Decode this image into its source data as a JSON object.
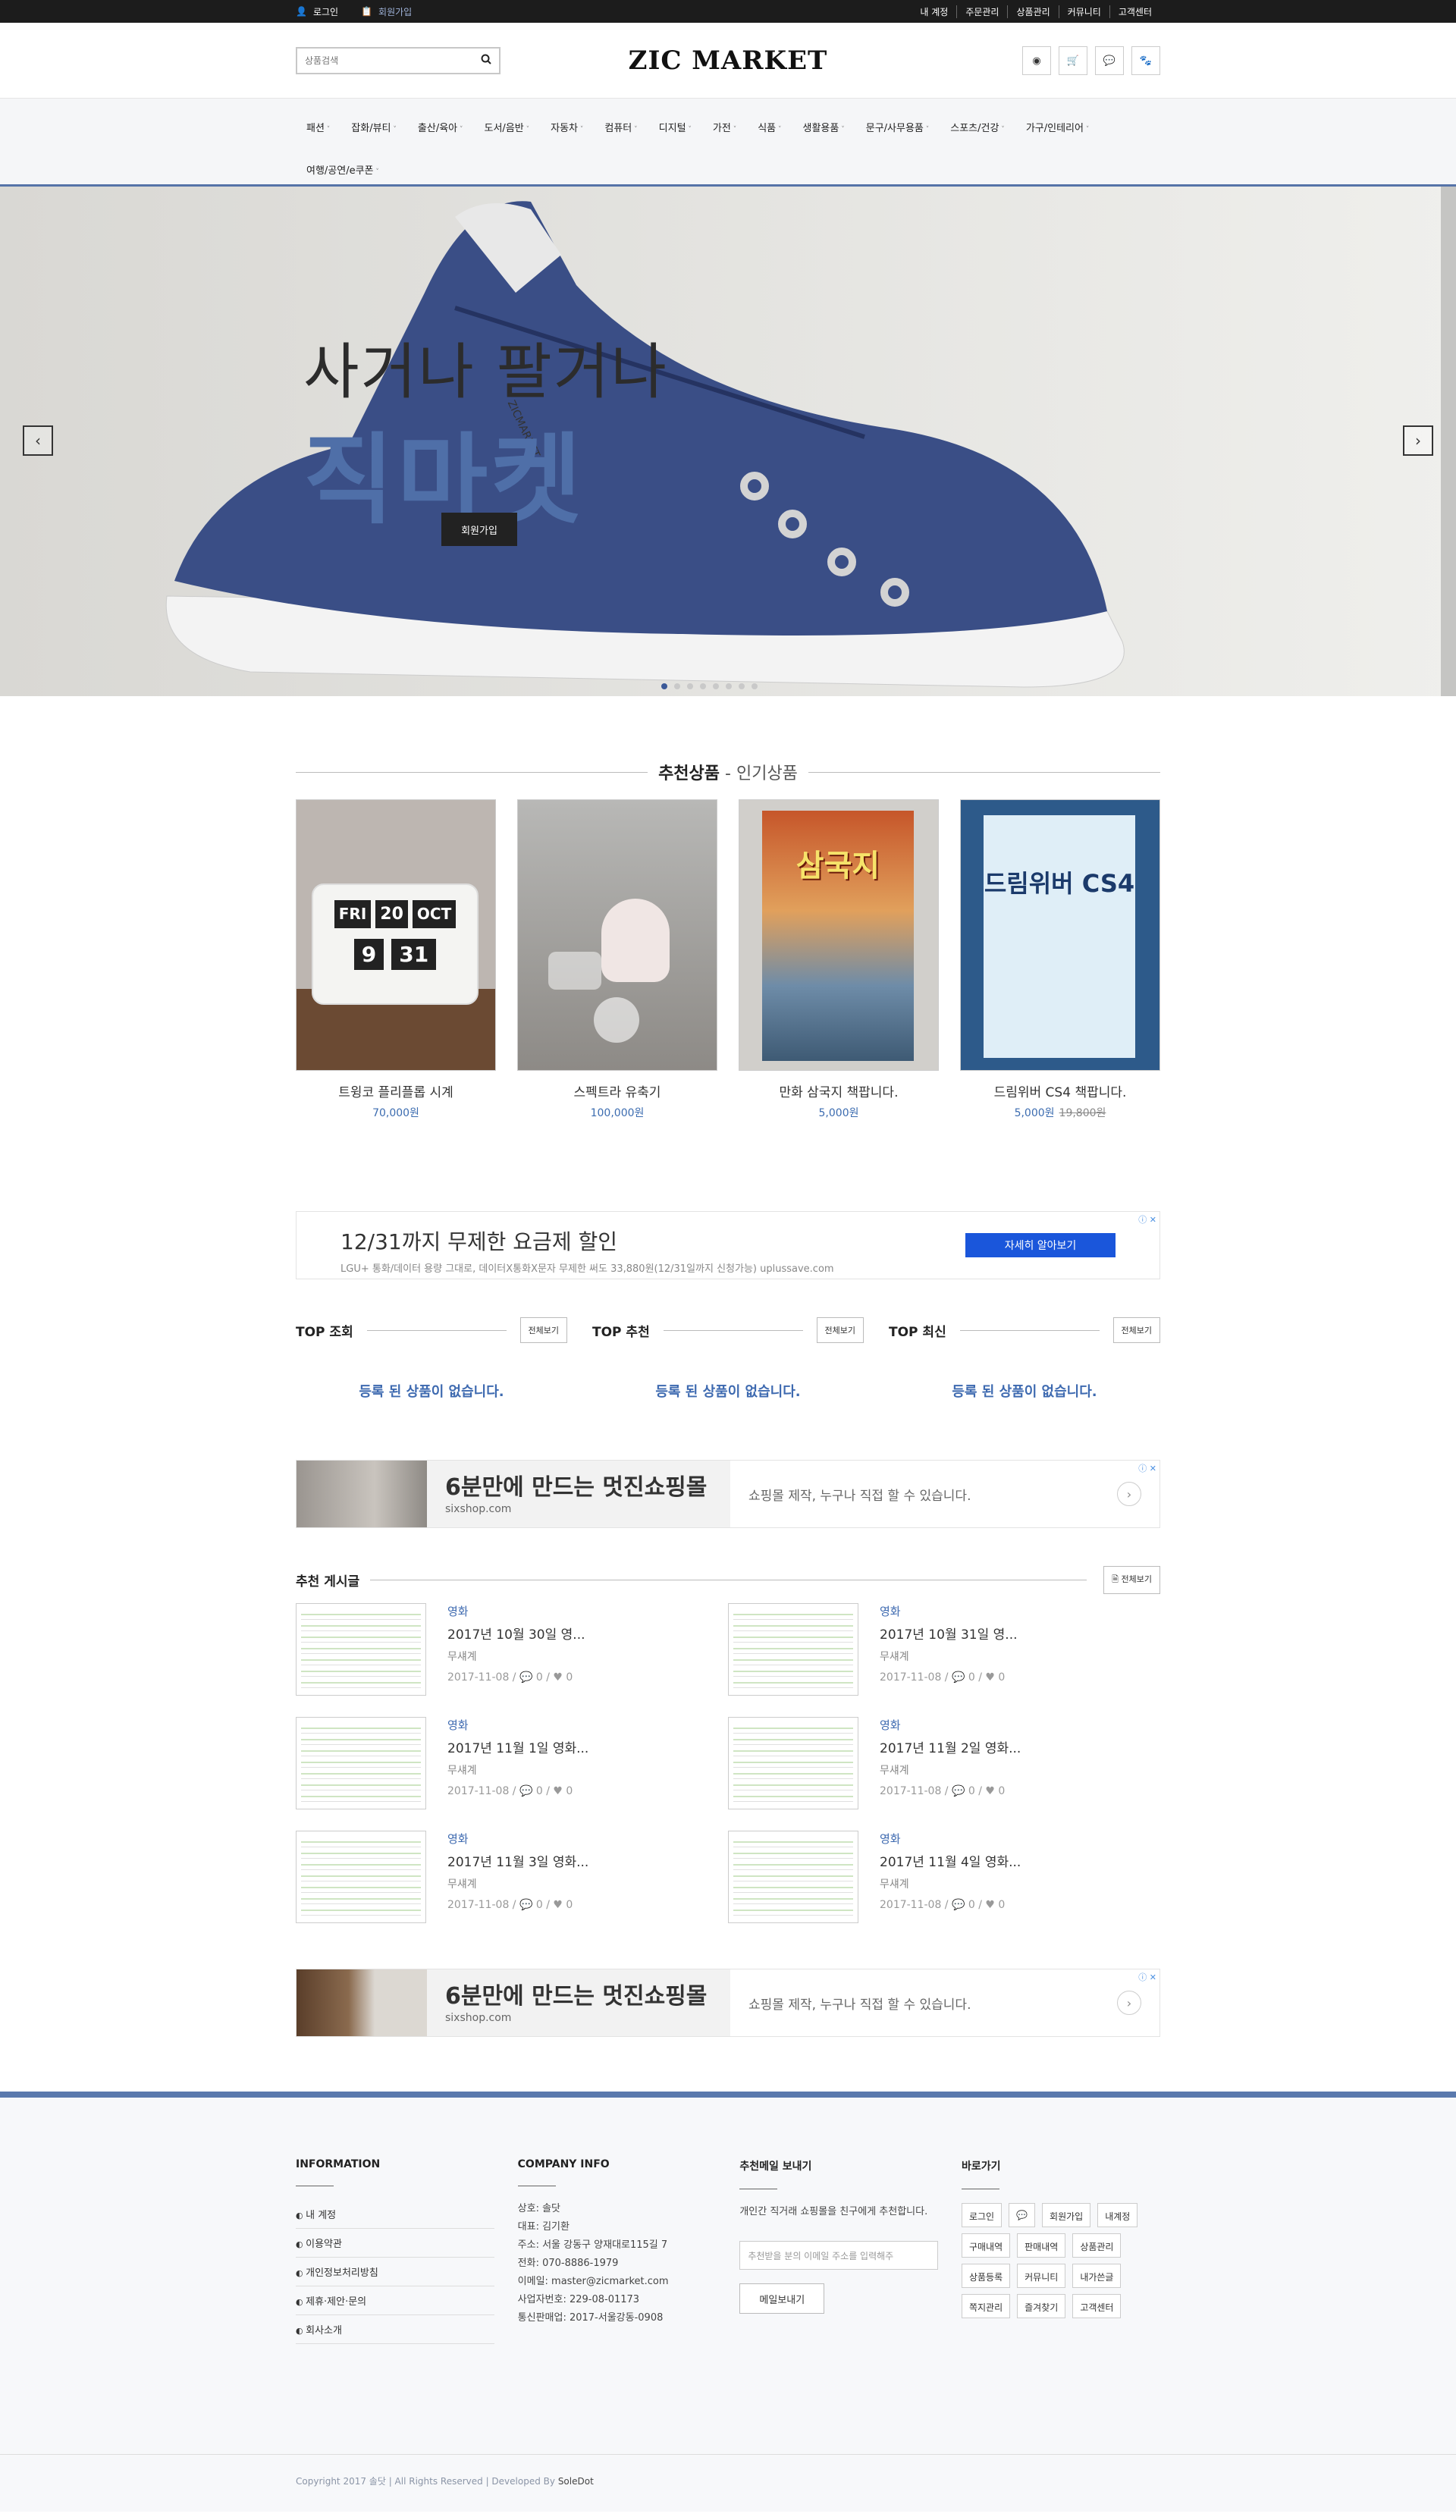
{
  "topbar": {
    "login": "로그인",
    "join": "회원가입",
    "links": [
      "내 계정",
      "주문관리",
      "상품관리",
      "커뮤니티",
      "고객센터"
    ]
  },
  "header": {
    "search_placeholder": "상품검색",
    "logo": "ZIC MARKET"
  },
  "nav": [
    "패션",
    "잡화/뷰티",
    "출산/육아",
    "도서/음반",
    "자동차",
    "컴퓨터",
    "디지털",
    "가전",
    "식품",
    "생활용품",
    "문구/사무용품",
    "스포츠/건강",
    "가구/인테리어",
    "여행/공연/e쿠폰"
  ],
  "hero": {
    "sub": "사거나 팔거나",
    "main": "직마켓",
    "button": "회원가입",
    "brand_tag": "ZICMARKET"
  },
  "featured": {
    "title_bold": "추천상품",
    "title_light": "- 인기상품",
    "items": [
      {
        "name": "트윙코 플리플롭 시계",
        "price": "70,000원",
        "old": ""
      },
      {
        "name": "스펙트라 유축기",
        "price": "100,000원",
        "old": ""
      },
      {
        "name": "만화 삼국지 책팝니다.",
        "price": "5,000원",
        "old": ""
      },
      {
        "name": "드림위버 CS4 책팝니다.",
        "price": "5,000원",
        "old": "19,800원"
      }
    ]
  },
  "clock": {
    "day": "FRI",
    "date": "20",
    "month": "OCT",
    "hour": "9",
    "minute": "31"
  },
  "book1": {
    "title": "삼국지"
  },
  "book2": {
    "title": "드림위버 CS4"
  },
  "ad1": {
    "headline": "12/31까지 무제한 요금제 할인",
    "desc": "LGU+ 통화/데이터 용량 그대로, 데이터X통화X문자 무제한 써도 33,880원(12/31일까지 신청가능) uplussave.com",
    "button": "자세히 알아보기",
    "badge": "ⓘ ✕"
  },
  "tops": [
    {
      "title": "TOP 조회",
      "btn": "전체보기",
      "empty": "등록 된 상품이 없습니다."
    },
    {
      "title": "TOP 추천",
      "btn": "전체보기",
      "empty": "등록 된 상품이 없습니다."
    },
    {
      "title": "TOP 최신",
      "btn": "전체보기",
      "empty": "등록 된 상품이 없습니다."
    }
  ],
  "ad2": {
    "headline": "6분만에 만드는 멋진쇼핑몰",
    "site": "sixshop.com",
    "desc": "쇼핑몰 제작, 누구나 직접 할 수 있습니다.",
    "badge": "ⓘ ✕"
  },
  "posts": {
    "title": "추천 게시글",
    "btn": "전체보기",
    "items": [
      {
        "cat": "영화",
        "title": "2017년 10월 30일 영...",
        "author": "무섀계",
        "meta": "2017-11-08 / 💬 0 / ♥ 0"
      },
      {
        "cat": "영화",
        "title": "2017년 10월 31일 영...",
        "author": "무섀계",
        "meta": "2017-11-08 / 💬 0 / ♥ 0"
      },
      {
        "cat": "영화",
        "title": "2017년 11월 1일 영화...",
        "author": "무섀계",
        "meta": "2017-11-08 / 💬 0 / ♥ 0"
      },
      {
        "cat": "영화",
        "title": "2017년 11월 2일 영화...",
        "author": "무섀계",
        "meta": "2017-11-08 / 💬 0 / ♥ 0"
      },
      {
        "cat": "영화",
        "title": "2017년 11월 3일 영화...",
        "author": "무섀계",
        "meta": "2017-11-08 / 💬 0 / ♥ 0"
      },
      {
        "cat": "영화",
        "title": "2017년 11월 4일 영화...",
        "author": "무섀계",
        "meta": "2017-11-08 / 💬 0 / ♥ 0"
      }
    ]
  },
  "footer": {
    "info_title": "INFORMATION",
    "info_links": [
      "내 계정",
      "이용약관",
      "개인정보처리방침",
      "제휴·제안·문의",
      "회사소개"
    ],
    "company_title": "COMPANY INFO",
    "company_lines": [
      "상호: 솔닷",
      "대표: 김기환",
      "주소: 서울 강동구 양재대로115길 7",
      "전화: 070-8886-1979",
      "이메일: master@zicmarket.com",
      "사업자번호: 229-08-01173",
      "통신판매업: 2017-서울강동-0908"
    ],
    "mail_title": "추천메일 보내기",
    "mail_desc": "개인간 직거래 쇼핑몰을 친구에게 추천합니다.",
    "mail_placeholder": "추천받을 분의 이메일 주소를 입력해주",
    "mail_button": "메일보내기",
    "quick_title": "바로가기",
    "quick_links": [
      "로그인",
      "💬",
      "회원가입",
      "내계정",
      "구매내역",
      "판매내역",
      "상품관리",
      "상품등록",
      "커뮤니티",
      "내가쓴글",
      "쪽지관리",
      "즐겨찾기",
      "고객센터"
    ]
  },
  "copyright": {
    "text": "Copyright 2017 솔닷 | All Rights Reserved | Developed By ",
    "dev": "SoleDot"
  }
}
